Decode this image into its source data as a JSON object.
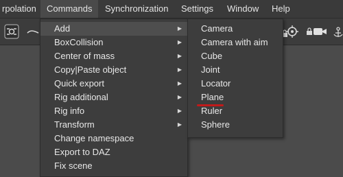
{
  "menubar": {
    "items": [
      {
        "label": "rpolation"
      },
      {
        "label": "Commands"
      },
      {
        "label": "Synchronization"
      },
      {
        "label": "Settings"
      },
      {
        "label": "Window"
      },
      {
        "label": "Help"
      }
    ]
  },
  "toolbar": {
    "icons": [
      "view-toggle-icon",
      "curve-icon",
      "lock-icon",
      "target-icon",
      "camera-icon",
      "lock-icon",
      "anchor-icon"
    ]
  },
  "commands_menu": {
    "items": [
      {
        "label": "Add",
        "submenu": true
      },
      {
        "label": "BoxCollision",
        "submenu": true
      },
      {
        "label": "Center of mass",
        "submenu": true
      },
      {
        "label": "Copy|Paste object",
        "submenu": true
      },
      {
        "label": "Quick export",
        "submenu": true
      },
      {
        "label": "Rig additional",
        "submenu": true
      },
      {
        "label": "Rig info",
        "submenu": true
      },
      {
        "label": "Transform",
        "submenu": true
      },
      {
        "label": "Change namespace",
        "submenu": false
      },
      {
        "label": "Export to DAZ",
        "submenu": false
      },
      {
        "label": "Fix scene",
        "submenu": false
      }
    ],
    "arrow_glyph": "▶"
  },
  "add_submenu": {
    "items": [
      {
        "label": "Camera"
      },
      {
        "label": "Camera with aim"
      },
      {
        "label": "Cube"
      },
      {
        "label": "Joint"
      },
      {
        "label": "Locator"
      },
      {
        "label": "Plane"
      },
      {
        "label": "Ruler"
      },
      {
        "label": "Sphere"
      }
    ],
    "annotated_item": "Plane",
    "annotation_color": "#c21a1a"
  },
  "colors": {
    "menubar_bg": "#3a3a3a",
    "menu_bg": "#3d3d3d",
    "highlight_bg": "#4e4e4e",
    "workspace_bg": "#4b4b4b"
  }
}
